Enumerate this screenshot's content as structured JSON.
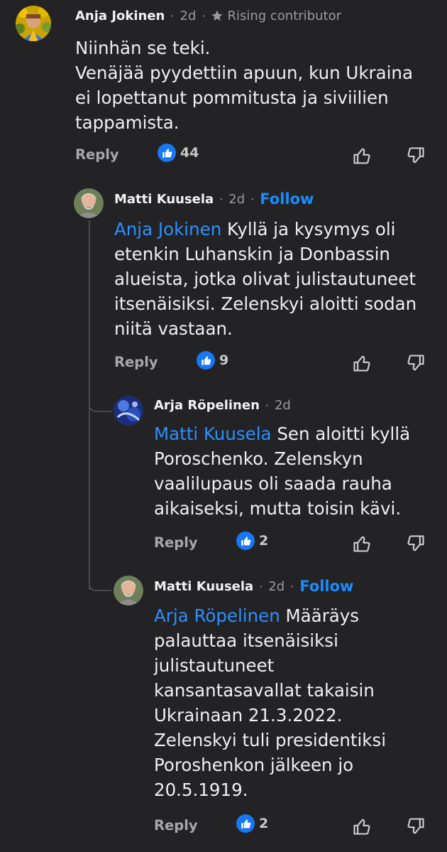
{
  "comments": [
    {
      "author": "Anja Jokinen",
      "time": "2d",
      "badge": "Rising contributor",
      "text": "Niinhän se teki.\nVenäjää pyydettiin apuun, kun Ukraina ei lopettanut pommitusta ja siviilien tappamista.",
      "reply_label": "Reply",
      "likes": "44"
    },
    {
      "author": "Matti Kuusela",
      "time": "2d",
      "follow_label": "Follow",
      "mention": "Anja Jokinen",
      "text": "Kyllä ja kysymys oli etenkin Luhanskin ja Donbassin alueista, jotka olivat julistautuneet itsenäisiksi. Zelenskyi aloitti sodan niitä vastaan.",
      "reply_label": "Reply",
      "likes": "9"
    },
    {
      "author": "Arja Röpelinen",
      "time": "2d",
      "mention": "Matti Kuusela",
      "text": "Sen aloitti kyllä Poroschenko. Zelenskyn vaalilupaus oli saada rauha aikaiseksi, mutta toisin kävi.",
      "reply_label": "Reply",
      "likes": "2"
    },
    {
      "author": "Matti Kuusela",
      "time": "2d",
      "follow_label": "Follow",
      "mention": "Arja Röpelinen",
      "text": "Määräys palauttaa itsenäisiksi julistautuneet kansantasavallat takaisin Ukrainaan 21.3.2022. Zelenskyi tuli presidentiksi Poroshenkon jälkeen jo 20.5.1919.",
      "reply_label": "Reply",
      "likes": "2"
    }
  ],
  "separator": "·",
  "colors": {
    "background": "#232325",
    "link": "#1a8cff",
    "like": "#1877f2"
  }
}
